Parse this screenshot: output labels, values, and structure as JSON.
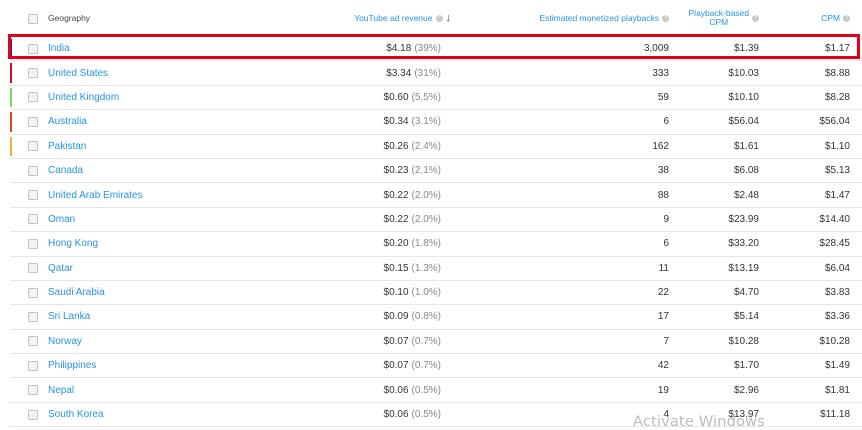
{
  "header": {
    "geography": "Geography",
    "revenue": "YouTube ad revenue",
    "playbacks": "Estimated monetized playbacks",
    "pb_cpm_line1": "Playback-based",
    "pb_cpm_line2": "CPM",
    "cpm": "CPM",
    "sort_icon": "arrow-down-icon",
    "help_icon": "help-icon"
  },
  "rows": [
    {
      "geo": "India",
      "rev": "$4.18",
      "pct": "(39%)",
      "plays": "3,009",
      "pcpm": "$1.39",
      "cpm": "$1.17",
      "bar": "#3b2a7a"
    },
    {
      "geo": "United States",
      "rev": "$3.34",
      "pct": "(31%)",
      "plays": "333",
      "pcpm": "$10.03",
      "cpm": "$8.88",
      "bar": "#c8102e"
    },
    {
      "geo": "United Kingdom",
      "rev": "$0.60",
      "pct": "(5.5%)",
      "plays": "59",
      "pcpm": "$10.10",
      "cpm": "$8.28",
      "bar": "#7ed957"
    },
    {
      "geo": "Australia",
      "rev": "$0.34",
      "pct": "(3.1%)",
      "plays": "6",
      "pcpm": "$56.04",
      "cpm": "$56.04",
      "bar": "#d9481f"
    },
    {
      "geo": "Pakistan",
      "rev": "$0.26",
      "pct": "(2.4%)",
      "plays": "162",
      "pcpm": "$1.61",
      "cpm": "$1.10",
      "bar": "#f2b632"
    },
    {
      "geo": "Canada",
      "rev": "$0.23",
      "pct": "(2.1%)",
      "plays": "38",
      "pcpm": "$6.08",
      "cpm": "$5.13",
      "bar": ""
    },
    {
      "geo": "United Arab Emirates",
      "rev": "$0.22",
      "pct": "(2.0%)",
      "plays": "88",
      "pcpm": "$2.48",
      "cpm": "$1.47",
      "bar": ""
    },
    {
      "geo": "Oman",
      "rev": "$0.22",
      "pct": "(2.0%)",
      "plays": "9",
      "pcpm": "$23.99",
      "cpm": "$14.40",
      "bar": ""
    },
    {
      "geo": "Hong Kong",
      "rev": "$0.20",
      "pct": "(1.8%)",
      "plays": "6",
      "pcpm": "$33.20",
      "cpm": "$28.45",
      "bar": ""
    },
    {
      "geo": "Qatar",
      "rev": "$0.15",
      "pct": "(1.3%)",
      "plays": "11",
      "pcpm": "$13.19",
      "cpm": "$6.04",
      "bar": ""
    },
    {
      "geo": "Saudi Arabia",
      "rev": "$0.10",
      "pct": "(1.0%)",
      "plays": "22",
      "pcpm": "$4.70",
      "cpm": "$3.83",
      "bar": ""
    },
    {
      "geo": "Sri Lanka",
      "rev": "$0.09",
      "pct": "(0.8%)",
      "plays": "17",
      "pcpm": "$5.14",
      "cpm": "$3.36",
      "bar": ""
    },
    {
      "geo": "Norway",
      "rev": "$0.07",
      "pct": "(0.7%)",
      "plays": "7",
      "pcpm": "$10.28",
      "cpm": "$10.28",
      "bar": ""
    },
    {
      "geo": "Philippines",
      "rev": "$0.07",
      "pct": "(0.7%)",
      "plays": "42",
      "pcpm": "$1.70",
      "cpm": "$1.49",
      "bar": ""
    },
    {
      "geo": "Nepal",
      "rev": "$0.06",
      "pct": "(0.5%)",
      "plays": "19",
      "pcpm": "$2.96",
      "cpm": "$1.81",
      "bar": ""
    },
    {
      "geo": "South Korea",
      "rev": "$0.06",
      "pct": "(0.5%)",
      "plays": "4",
      "pcpm": "$13.97",
      "cpm": "$11.18",
      "bar": ""
    }
  ],
  "highlight_color": "#e0001b",
  "link_color": "#2793e6",
  "watermark": "Activate Windows"
}
